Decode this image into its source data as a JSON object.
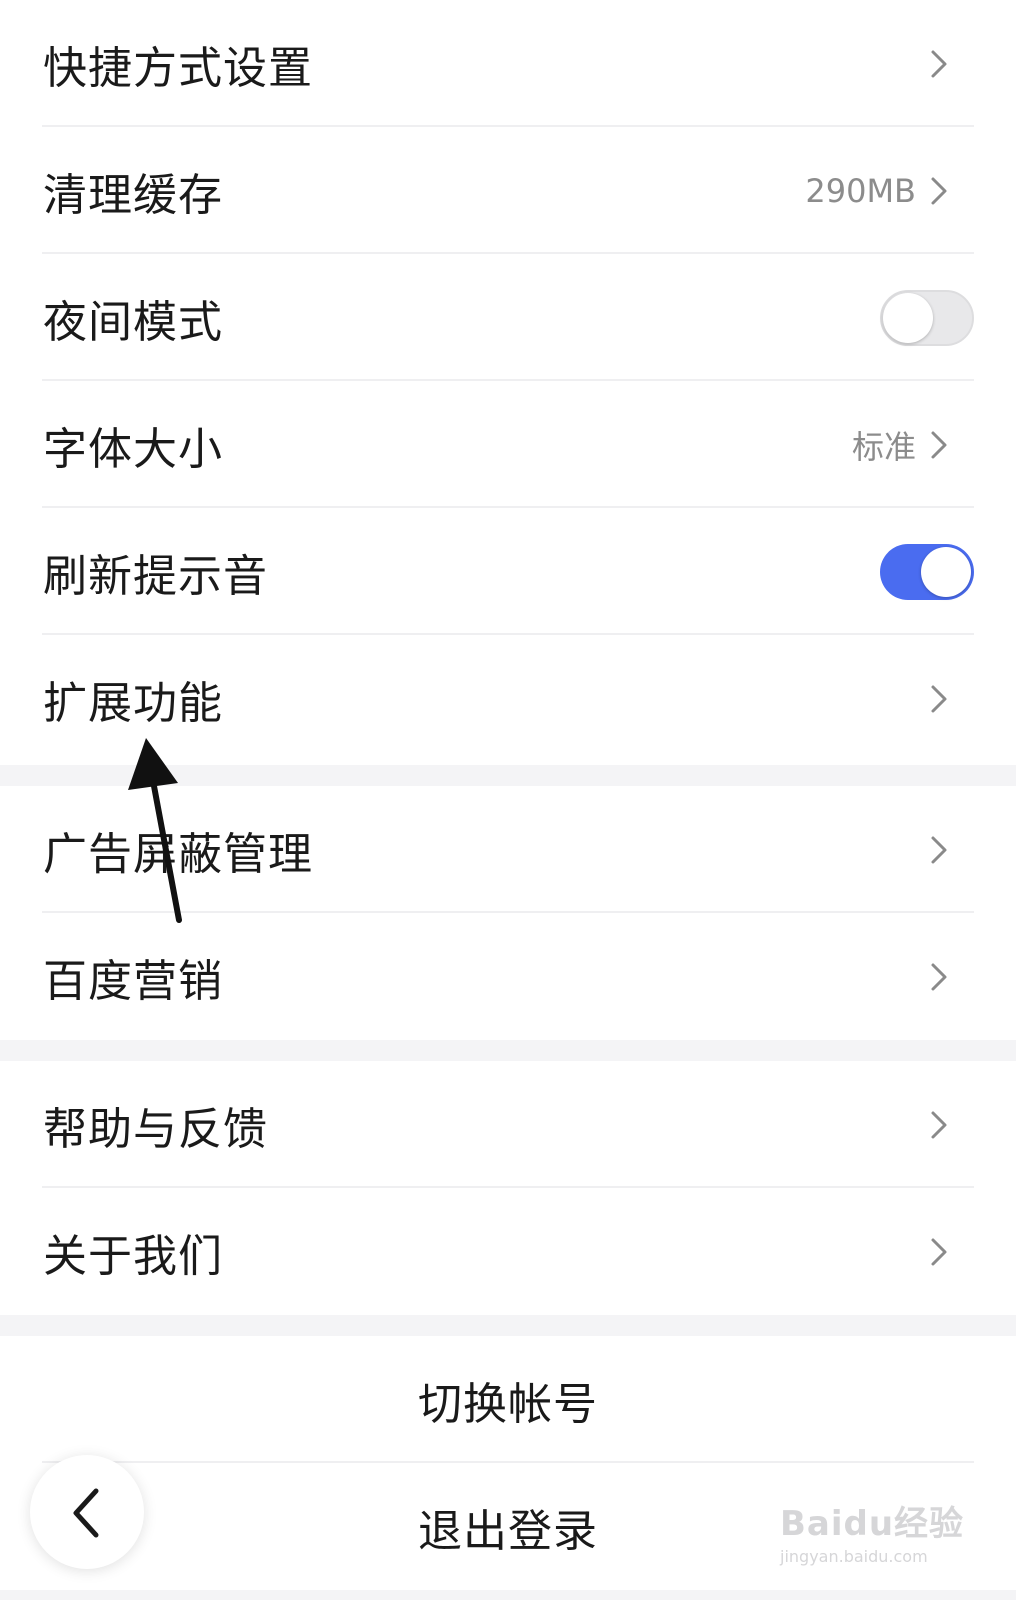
{
  "settings": {
    "group1": [
      {
        "label": "快捷方式设置",
        "type": "link"
      },
      {
        "label": "清理缓存",
        "type": "link",
        "value": "290MB"
      },
      {
        "label": "夜间模式",
        "type": "toggle",
        "on": false
      },
      {
        "label": "字体大小",
        "type": "link",
        "value": "标准"
      },
      {
        "label": "刷新提示音",
        "type": "toggle",
        "on": true
      },
      {
        "label": "扩展功能",
        "type": "link"
      }
    ],
    "group2": [
      {
        "label": "广告屏蔽管理",
        "type": "link"
      },
      {
        "label": "百度营销",
        "type": "link"
      }
    ],
    "group3": [
      {
        "label": "帮助与反馈",
        "type": "link"
      },
      {
        "label": "关于我们",
        "type": "link"
      }
    ],
    "group4": [
      {
        "label": "切换帐号"
      },
      {
        "label": "退出登录"
      }
    ]
  },
  "colors": {
    "toggle_on": "#4a6cf0",
    "page_bg": "#f4f4f6",
    "row_bg": "#ffffff"
  },
  "icons": {
    "row_arrow": "chevron-right-icon",
    "back": "chevron-left-icon"
  },
  "watermark": {
    "main": "Baidu经验",
    "sub": "jingyan.baidu.com"
  }
}
